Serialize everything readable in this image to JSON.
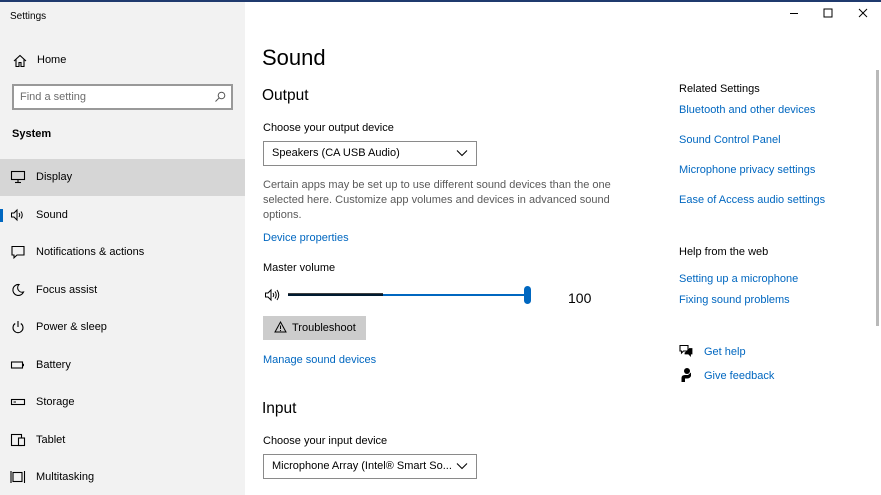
{
  "window": {
    "title": "Settings"
  },
  "sidebar": {
    "home_label": "Home",
    "search_placeholder": "Find a setting",
    "section_label": "System",
    "items": [
      {
        "label": "Display",
        "icon": "monitor-icon",
        "selected": true
      },
      {
        "label": "Sound",
        "icon": "speaker-icon",
        "active": true
      },
      {
        "label": "Notifications & actions",
        "icon": "notification-icon"
      },
      {
        "label": "Focus assist",
        "icon": "moon-icon"
      },
      {
        "label": "Power & sleep",
        "icon": "power-icon"
      },
      {
        "label": "Battery",
        "icon": "battery-icon"
      },
      {
        "label": "Storage",
        "icon": "storage-icon"
      },
      {
        "label": "Tablet",
        "icon": "tablet-icon"
      },
      {
        "label": "Multitasking",
        "icon": "multitasking-icon"
      }
    ]
  },
  "main": {
    "title": "Sound",
    "output": {
      "heading": "Output",
      "device_label": "Choose your output device",
      "device_value": "Speakers (CA USB Audio)",
      "description": "Certain apps may be set up to use different sound devices than the one selected here. Customize app volumes and devices in advanced sound options.",
      "device_properties_link": "Device properties",
      "master_volume_label": "Master volume",
      "volume_value": "100",
      "troubleshoot_label": "Troubleshoot",
      "manage_link": "Manage sound devices"
    },
    "input": {
      "heading": "Input",
      "device_label": "Choose your input device",
      "device_value": "Microphone Array (Intel® Smart So..."
    }
  },
  "related": {
    "title": "Related Settings",
    "links": [
      "Bluetooth and other devices",
      "Sound Control Panel",
      "Microphone privacy settings",
      "Ease of Access audio settings"
    ]
  },
  "help": {
    "title": "Help from the web",
    "links": [
      "Setting up a microphone",
      "Fixing sound problems"
    ],
    "get_help": "Get help",
    "give_feedback": "Give feedback"
  },
  "colors": {
    "accent": "#0067c0",
    "sidebar_bg": "#f2f2f2",
    "selected_bg": "#d6d6d6"
  }
}
